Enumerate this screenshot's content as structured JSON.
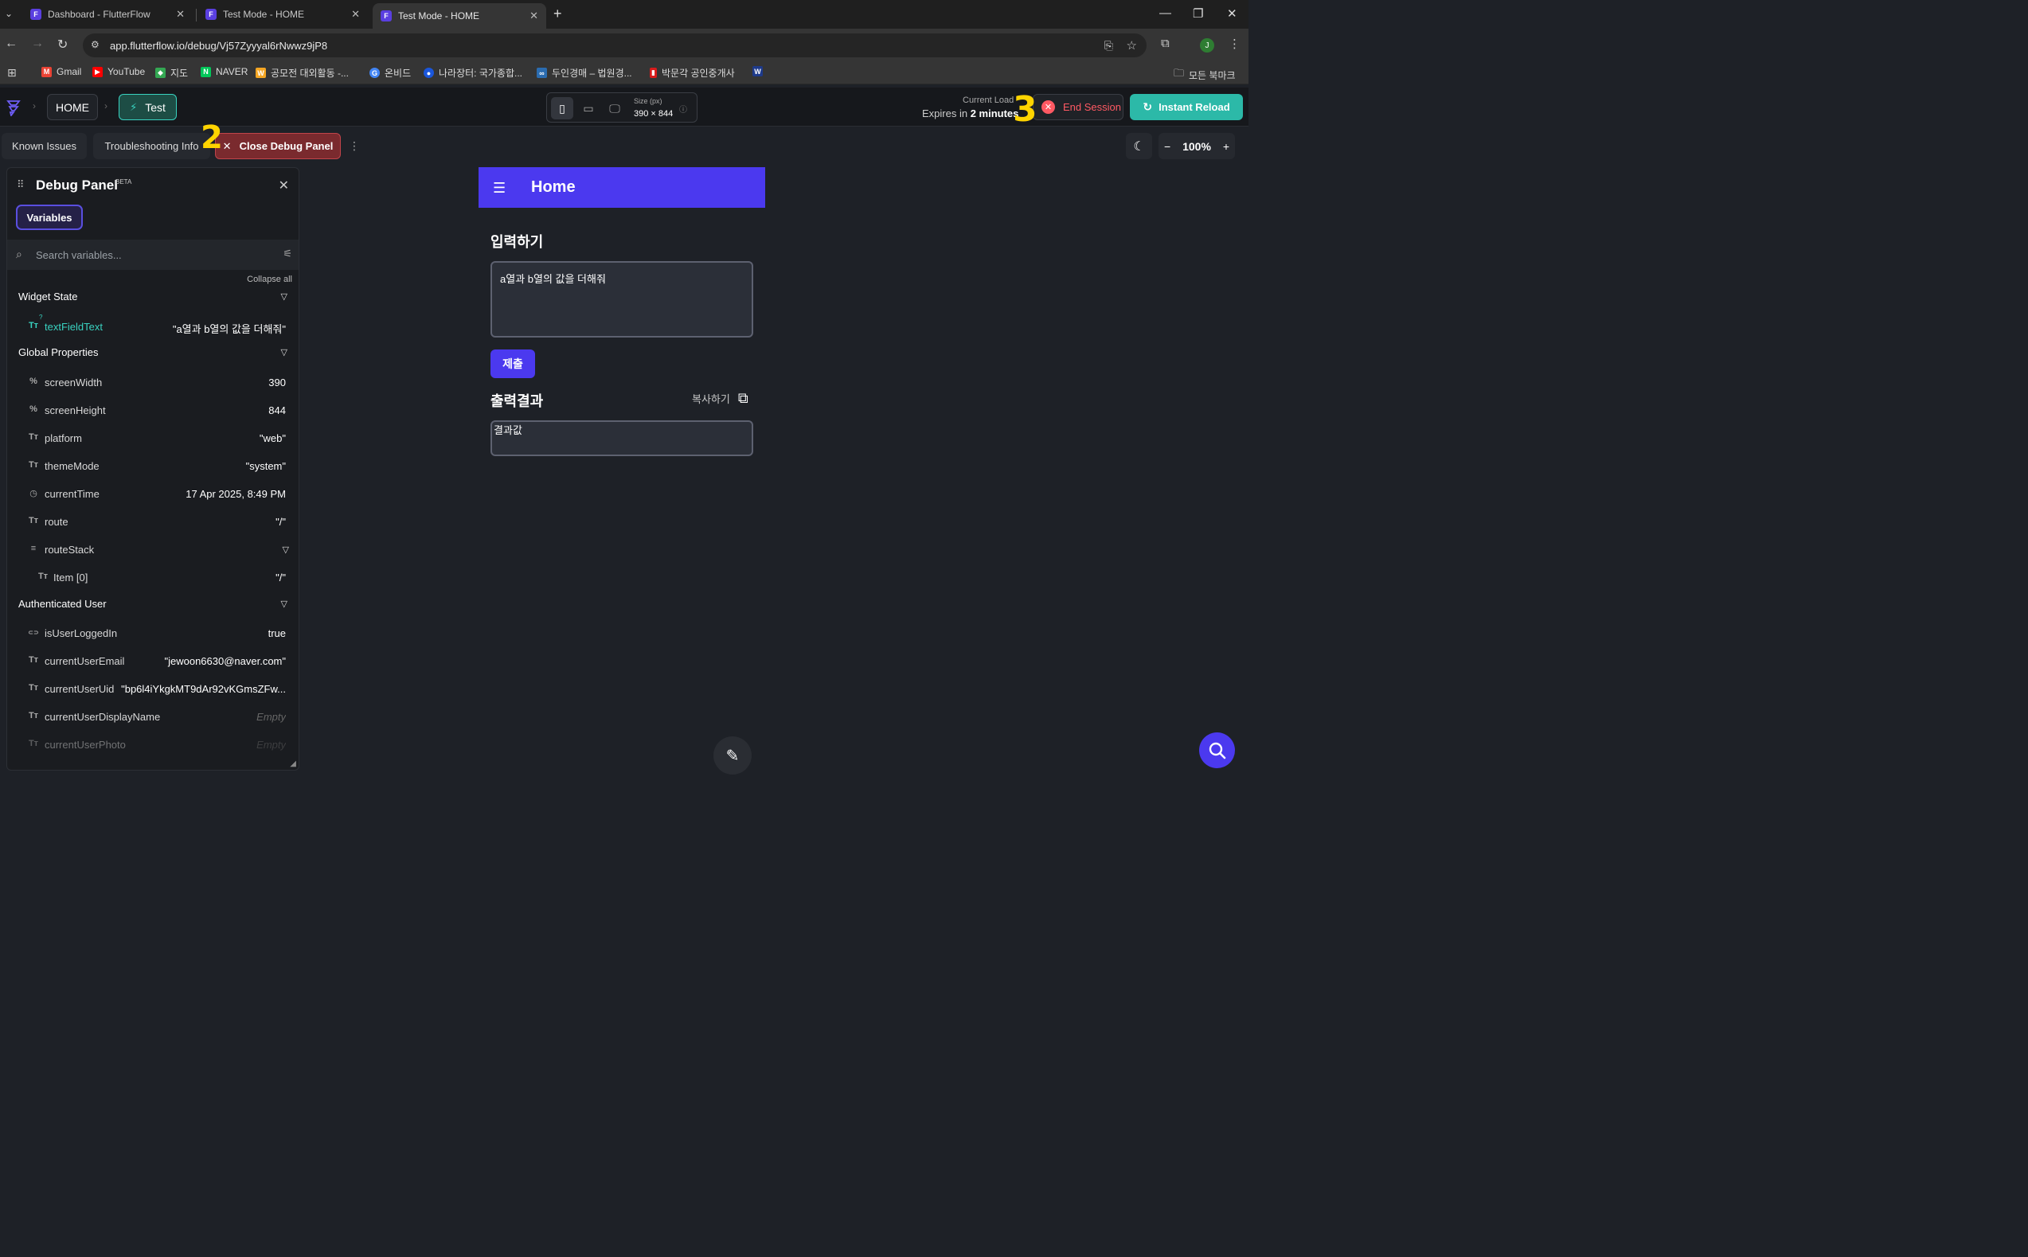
{
  "browser": {
    "tabs": [
      {
        "title": "Dashboard - FlutterFlow"
      },
      {
        "title": "Test Mode - HOME"
      },
      {
        "title": "Test Mode - HOME"
      }
    ],
    "url": "app.flutterflow.io/debug/Vj57Zyyyal6rNwwz9jP8",
    "profile_initial": "J",
    "bookmarks": [
      {
        "label": "Gmail",
        "color": "#ea4335",
        "glyph": "M"
      },
      {
        "label": "YouTube",
        "color": "#ff0000",
        "glyph": "▶"
      },
      {
        "label": "지도",
        "color": "#34a853",
        "glyph": "◆"
      },
      {
        "label": "NAVER",
        "color": "#03c75a",
        "glyph": "N"
      },
      {
        "label": "공모전 대외활동 -...",
        "color": "#f5a623",
        "glyph": "W"
      },
      {
        "label": "온비드",
        "color": "#4285f4",
        "glyph": "G"
      },
      {
        "label": "나라장터: 국가종합...",
        "color": "#1a56db",
        "glyph": "●"
      },
      {
        "label": "두인경매 – 법원경...",
        "color": "#2b6cb0",
        "glyph": "∞"
      },
      {
        "label": "박문각 공인중개사",
        "color": "#d81b1b",
        "glyph": "▮"
      },
      {
        "label": "",
        "color": "#1e3a8a",
        "glyph": "W"
      }
    ],
    "all_bookmarks": "모든 북마크"
  },
  "ff_top": {
    "breadcrumb_page": "HOME",
    "test_label": "Test",
    "size_label": "Size (px)",
    "size_value": "390 × 844",
    "load_label": "Current Load",
    "expires_prefix": "Expires in",
    "expires_value": "2 minutes",
    "end_session": "End Session",
    "instant_reload": "Instant Reload"
  },
  "subbar": {
    "known_issues": "Known Issues",
    "troubleshooting": "Troubleshooting Info",
    "close_debug": "Close Debug Panel",
    "zoom": "100%"
  },
  "debug_panel": {
    "title": "Debug Panel",
    "beta": "BETA",
    "tab_variables": "Variables",
    "search_placeholder": "Search variables...",
    "collapse_all": "Collapse all",
    "sections": {
      "widget_state": "Widget State",
      "global_properties": "Global Properties",
      "authenticated_user": "Authenticated User"
    },
    "widget_state": [
      {
        "icon": "Tт",
        "name": "textFieldText",
        "value": "\"a열과 b열의 값을 더해줘\""
      }
    ],
    "global_properties": [
      {
        "icon": "%",
        "name": "screenWidth",
        "value": "390"
      },
      {
        "icon": "%",
        "name": "screenHeight",
        "value": "844"
      },
      {
        "icon": "Tт",
        "name": "platform",
        "value": "\"web\""
      },
      {
        "icon": "Tт",
        "name": "themeMode",
        "value": "\"system\""
      },
      {
        "icon": "◷",
        "name": "currentTime",
        "value": "17 Apr 2025, 8:49 PM"
      },
      {
        "icon": "Tт",
        "name": "route",
        "value": "\"/\""
      },
      {
        "icon": "≡",
        "name": "routeStack",
        "value": ""
      },
      {
        "icon": "Tт",
        "name": "Item [0]",
        "value": "\"/\""
      }
    ],
    "authenticated_user": [
      {
        "icon": "⊂⊃",
        "name": "isUserLoggedIn",
        "value": "true"
      },
      {
        "icon": "Tт",
        "name": "currentUserEmail",
        "value": "\"jewoon6630@naver.com\""
      },
      {
        "icon": "Tт",
        "name": "currentUserUid",
        "value": "\"bp6l4iYkgkMT9dAr92vKGmsZFw..."
      },
      {
        "icon": "Tт",
        "name": "currentUserDisplayName",
        "value": "Empty"
      },
      {
        "icon": "Tт",
        "name": "currentUserPhoto",
        "value": "Empty"
      }
    ]
  },
  "preview": {
    "appbar_title": "Home",
    "input_title": "입력하기",
    "input_value": "a열과 b열의 값을 더해줘",
    "submit_label": "제출",
    "output_title": "출력결과",
    "copy_label": "복사하기",
    "result_value": "결과값"
  },
  "annotations": [
    "2",
    "3"
  ]
}
